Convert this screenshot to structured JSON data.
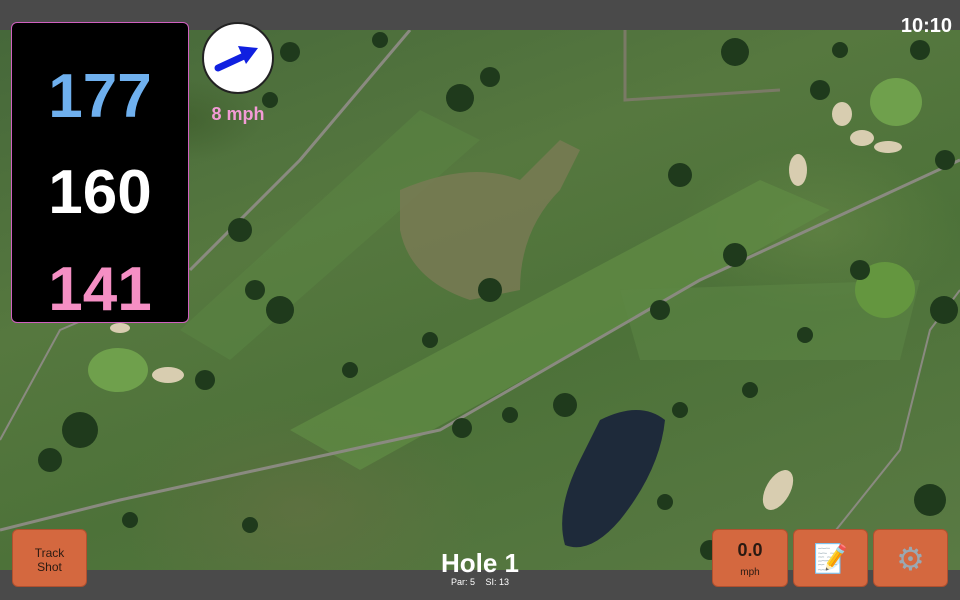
{
  "status": {
    "time": "10:10"
  },
  "yardage": {
    "back": "177",
    "middle": "160",
    "front": "141"
  },
  "wind": {
    "speed": "8 mph",
    "direction_icon": "arrow-right-icon"
  },
  "buttons": {
    "track_shot_line1": "Track",
    "track_shot_line2": "Shot",
    "speed_value": "0.0",
    "speed_unit": "mph",
    "notes_icon": "notepad-icon",
    "settings_icon": "gear-icon"
  },
  "hole": {
    "title": "Hole 1",
    "par": "Par: 5",
    "si": "SI: 13"
  },
  "colors": {
    "back": "#6fb0ee",
    "middle": "#ffffff",
    "front": "#f58fc4",
    "wind_text": "#f39bd6",
    "button_bg": "#d4683f",
    "arrow": "#1020e0"
  }
}
